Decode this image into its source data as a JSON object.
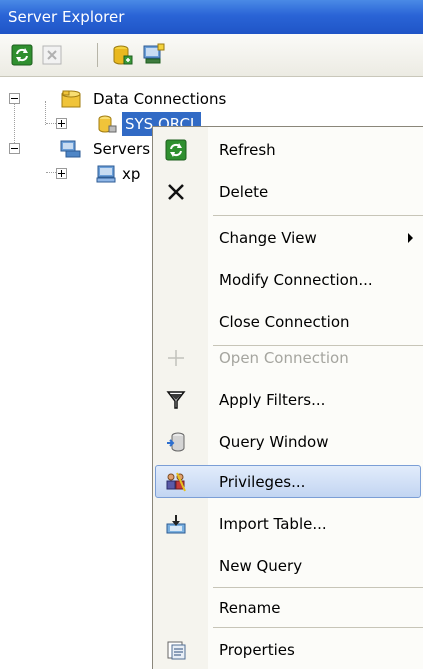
{
  "window": {
    "title": "Server Explorer"
  },
  "toolbar": {
    "buttons": [
      "refresh-icon",
      "stop-icon",
      "connect-to-database-icon",
      "connect-to-server-icon"
    ]
  },
  "tree": {
    "data_connections_label": "Data Connections",
    "connection_label": "SYS.ORCL",
    "servers_label": "Servers",
    "server_label": "xp"
  },
  "menu": {
    "refresh": "Refresh",
    "delete": "Delete",
    "change_view": "Change View",
    "modify_connection": "Modify Connection...",
    "close_connection": "Close Connection",
    "open_connection": "Open Connection",
    "apply_filters": "Apply Filters...",
    "query_window": "Query Window",
    "privileges": "Privileges...",
    "import_table": "Import Table...",
    "new_query": "New Query",
    "rename": "Rename",
    "properties": "Properties"
  },
  "colors": {
    "titlebar": "#2a64d6",
    "selection": "#316ac5",
    "menu_highlight": "#c2d5f2",
    "disabled_text": "#a5a59f"
  }
}
